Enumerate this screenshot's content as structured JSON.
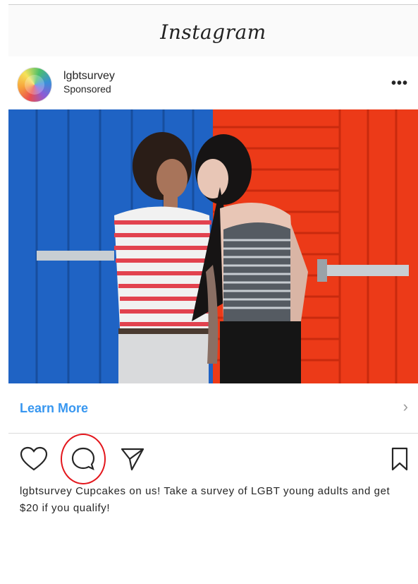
{
  "app": {
    "title": "Instagram"
  },
  "post": {
    "username": "lgbtsurvey",
    "sponsored_label": "Sponsored",
    "more_label": "•••",
    "image_alt": "Two women leaning together in front of blue and red doors"
  },
  "cta": {
    "label": "Learn More",
    "chevron": "›"
  },
  "actions": {
    "icons": [
      "heart-icon",
      "comment-icon",
      "share-icon",
      "bookmark-icon"
    ],
    "highlight_color": "#e3161c"
  },
  "caption": {
    "username": "lgbtsurvey",
    "text": " Cupcakes on us! Take a survey of LGBT young adults and get $20 if you qualify!"
  },
  "colors": {
    "link": "#3897f0",
    "text": "#262626",
    "divider": "#dbdbdb"
  }
}
